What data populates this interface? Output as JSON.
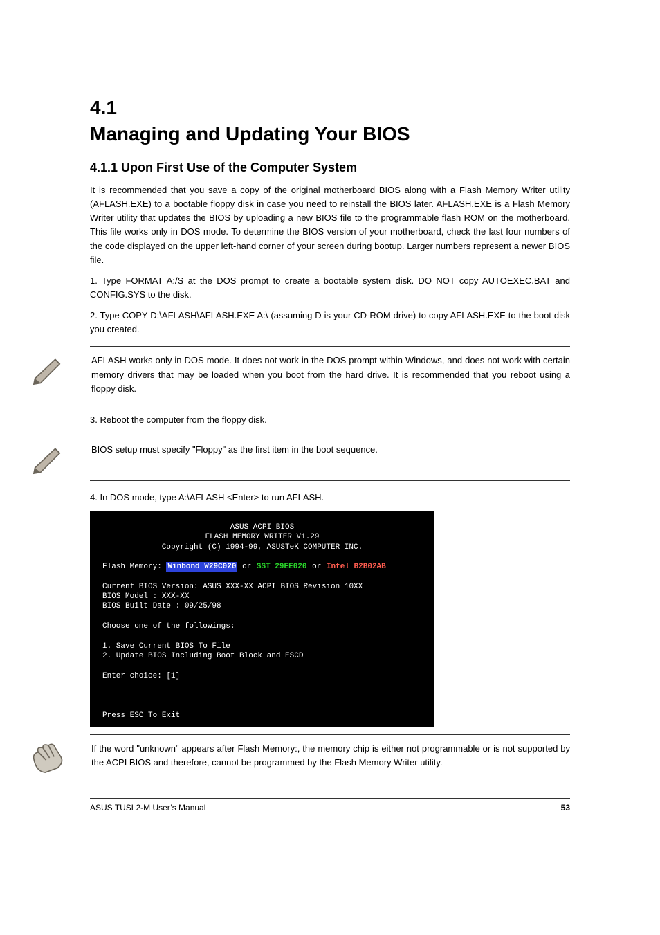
{
  "section": {
    "number_line": "4.1",
    "title_line": "Managing and Updating Your BIOS",
    "sub1": "4.1.1  Upon First Use of the Computer System",
    "intro": "It is recommended that you save a copy of the original motherboard BIOS along with a Flash Memory Writer utility (AFLASH.EXE) to a bootable floppy disk in case you need to reinstall the BIOS later. AFLASH.EXE is a Flash Memory Writer utility that updates the BIOS by uploading a new BIOS file to the programmable flash ROM on the motherboard. This file works only in DOS mode. To determine the BIOS version of your motherboard, check the last four numbers of the code displayed on the upper left-hand corner of your screen during bootup. Larger numbers represent a newer BIOS file.",
    "steps": [
      "1.  Type FORMAT A:/S at the DOS prompt to create a bootable system disk. DO NOT copy AUTOEXEC.BAT and CONFIG.SYS to the disk.",
      "2.  Type COPY D:\\AFLASH\\AFLASH.EXE A:\\ (assuming D is your CD-ROM drive) to copy AFLASH.EXE to the boot disk you created."
    ],
    "note1": "AFLASH works only in DOS mode. It does not work in the DOS prompt within Windows, and does not work with certain memory drivers that may be loaded when you boot from the hard drive. It is recommended that you reboot using a floppy disk.",
    "step3": "3.  Reboot the computer from the floppy disk.",
    "note2": "BIOS setup must specify \"Floppy\" as the first item in the boot sequence.",
    "step4": "4.  In DOS mode, type A:\\AFLASH <Enter> to run AFLASH.",
    "bios_box": {
      "h1": "ASUS ACPI BIOS",
      "h2": "FLASH MEMORY WRITER V1.29",
      "h3": "Copyright (C) 1994-99, ASUSTeK COMPUTER INC.",
      "flash_label": "Flash Memory:",
      "flash_v1": "Winbond W29C020",
      "flash_or1": "or",
      "flash_v2": "SST 29EE020",
      "flash_or2": "or",
      "flash_v3": "Intel B2B02AB",
      "line_ver": "Current BIOS Version: ASUS XXX-XX ACPI BIOS Revision 10XX",
      "line_model": "BIOS Model          : XXX-XX",
      "line_date": "BIOS Built Date     : 09/25/98",
      "choose": "Choose one of the followings:",
      "opt1": "1. Save Current BIOS To File",
      "opt2": "2. Update BIOS Including Boot Block and ESCD",
      "enter": "Enter choice: [1]",
      "esc": "Press ESC To Exit"
    },
    "note3": "If the word \"unknown\" appears after Flash Memory:, the memory chip is either not programmable or is not supported by the ACPI BIOS and therefore, cannot be programmed by the Flash Memory Writer utility."
  },
  "footer": {
    "left": "ASUS TUSL2-M User’s Manual",
    "page": "53"
  }
}
